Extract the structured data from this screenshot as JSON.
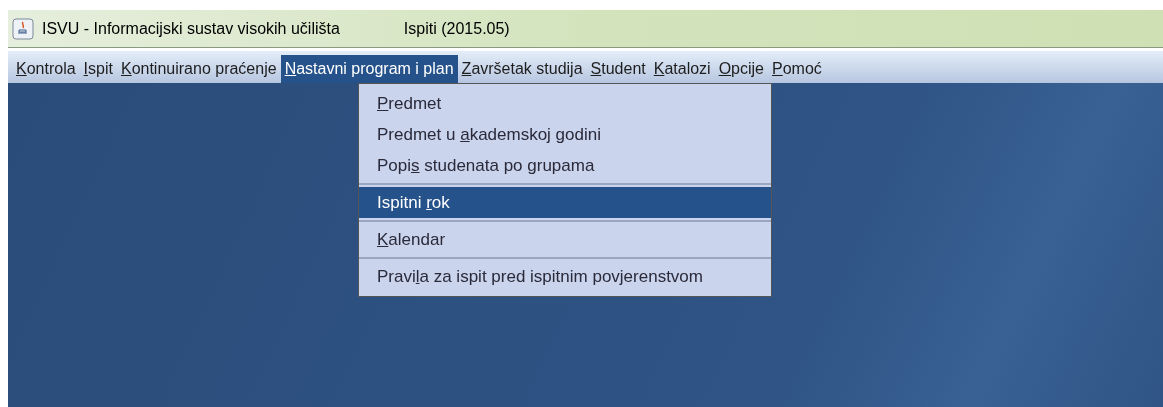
{
  "window": {
    "title": "ISVU - Informacijski sustav visokih učilišta",
    "subtitle": "Ispiti (2015.05)"
  },
  "menu_bar": [
    {
      "key": "K",
      "post": "ontrola",
      "selected": false
    },
    {
      "key": "I",
      "post": "spit",
      "selected": false
    },
    {
      "key": "K",
      "post": "ontinuirano praćenje",
      "selected": false
    },
    {
      "key": "N",
      "post": "astavni program i plan",
      "selected": true
    },
    {
      "key": "Z",
      "post": "avršetak studija",
      "selected": false
    },
    {
      "key": "S",
      "post": "tudent",
      "selected": false
    },
    {
      "key": "K",
      "post": "atalozi",
      "selected": false
    },
    {
      "key": "O",
      "post": "pcije",
      "selected": false
    },
    {
      "key": "P",
      "post": "omoć",
      "selected": false
    }
  ],
  "dropdown": {
    "groups": [
      [
        {
          "key": "P",
          "post": "redmet",
          "selected": false
        },
        {
          "pre": "Predmet u ",
          "key": "a",
          "post": "kademskoj godini",
          "selected": false
        },
        {
          "pre": "Popi",
          "key": "s",
          "post": " studenata po grupama",
          "selected": false
        }
      ],
      [
        {
          "pre": "Ispitni ",
          "key": "r",
          "post": "ok",
          "selected": true
        }
      ],
      [
        {
          "key": "K",
          "post": "alendar",
          "selected": false
        }
      ],
      [
        {
          "pre": "Pravi",
          "key": "l",
          "post": "a za ispit pred ispitnim povjerenstvom",
          "selected": false
        }
      ]
    ]
  }
}
